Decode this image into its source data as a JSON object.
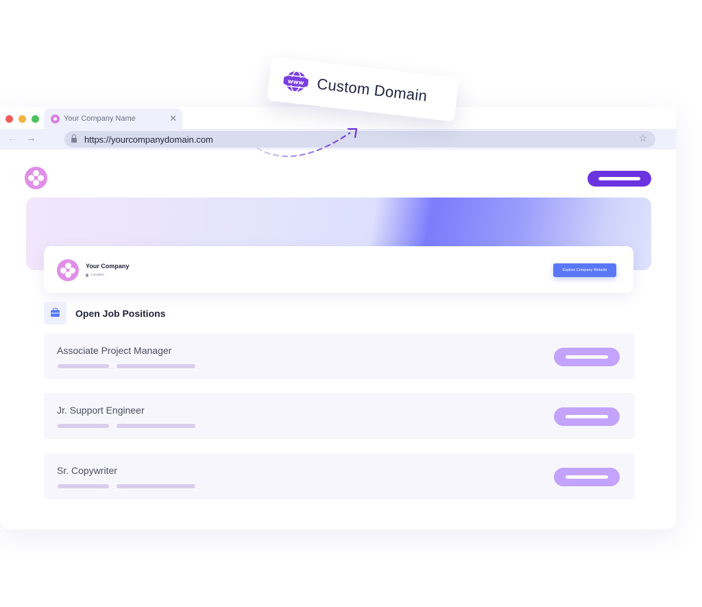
{
  "browser": {
    "tab": {
      "title": "Your Company Name",
      "close_icon": "close-icon",
      "favicon": "company-logo-icon"
    },
    "address_bar": {
      "url": "https://yourcompanydomain.com",
      "back_icon": "arrow-left-icon",
      "forward_icon": "arrow-right-icon",
      "lock_icon": "lock-icon",
      "bookmark_icon": "star-icon"
    },
    "traffic_lights": [
      "close",
      "minimize",
      "maximize"
    ]
  },
  "callout": {
    "label": "Custom Domain",
    "icon": "www-globe-icon"
  },
  "company": {
    "name": "Your Company",
    "location": "Location",
    "explore_button": "Explore Company Website"
  },
  "jobs": {
    "section_title": "Open Job Positions",
    "section_icon": "briefcase-icon",
    "items": [
      {
        "title": "Associate Project Manager"
      },
      {
        "title": "Jr. Support Engineer"
      },
      {
        "title": "Sr. Copywriter"
      }
    ]
  },
  "colors": {
    "brand_purple": "#6b34e0",
    "logo_pink": "#e08fe8",
    "explore_blue": "#5a78f5",
    "apply_lavender": "#c3a3fc",
    "banner_accent": "#7c7cfc"
  }
}
